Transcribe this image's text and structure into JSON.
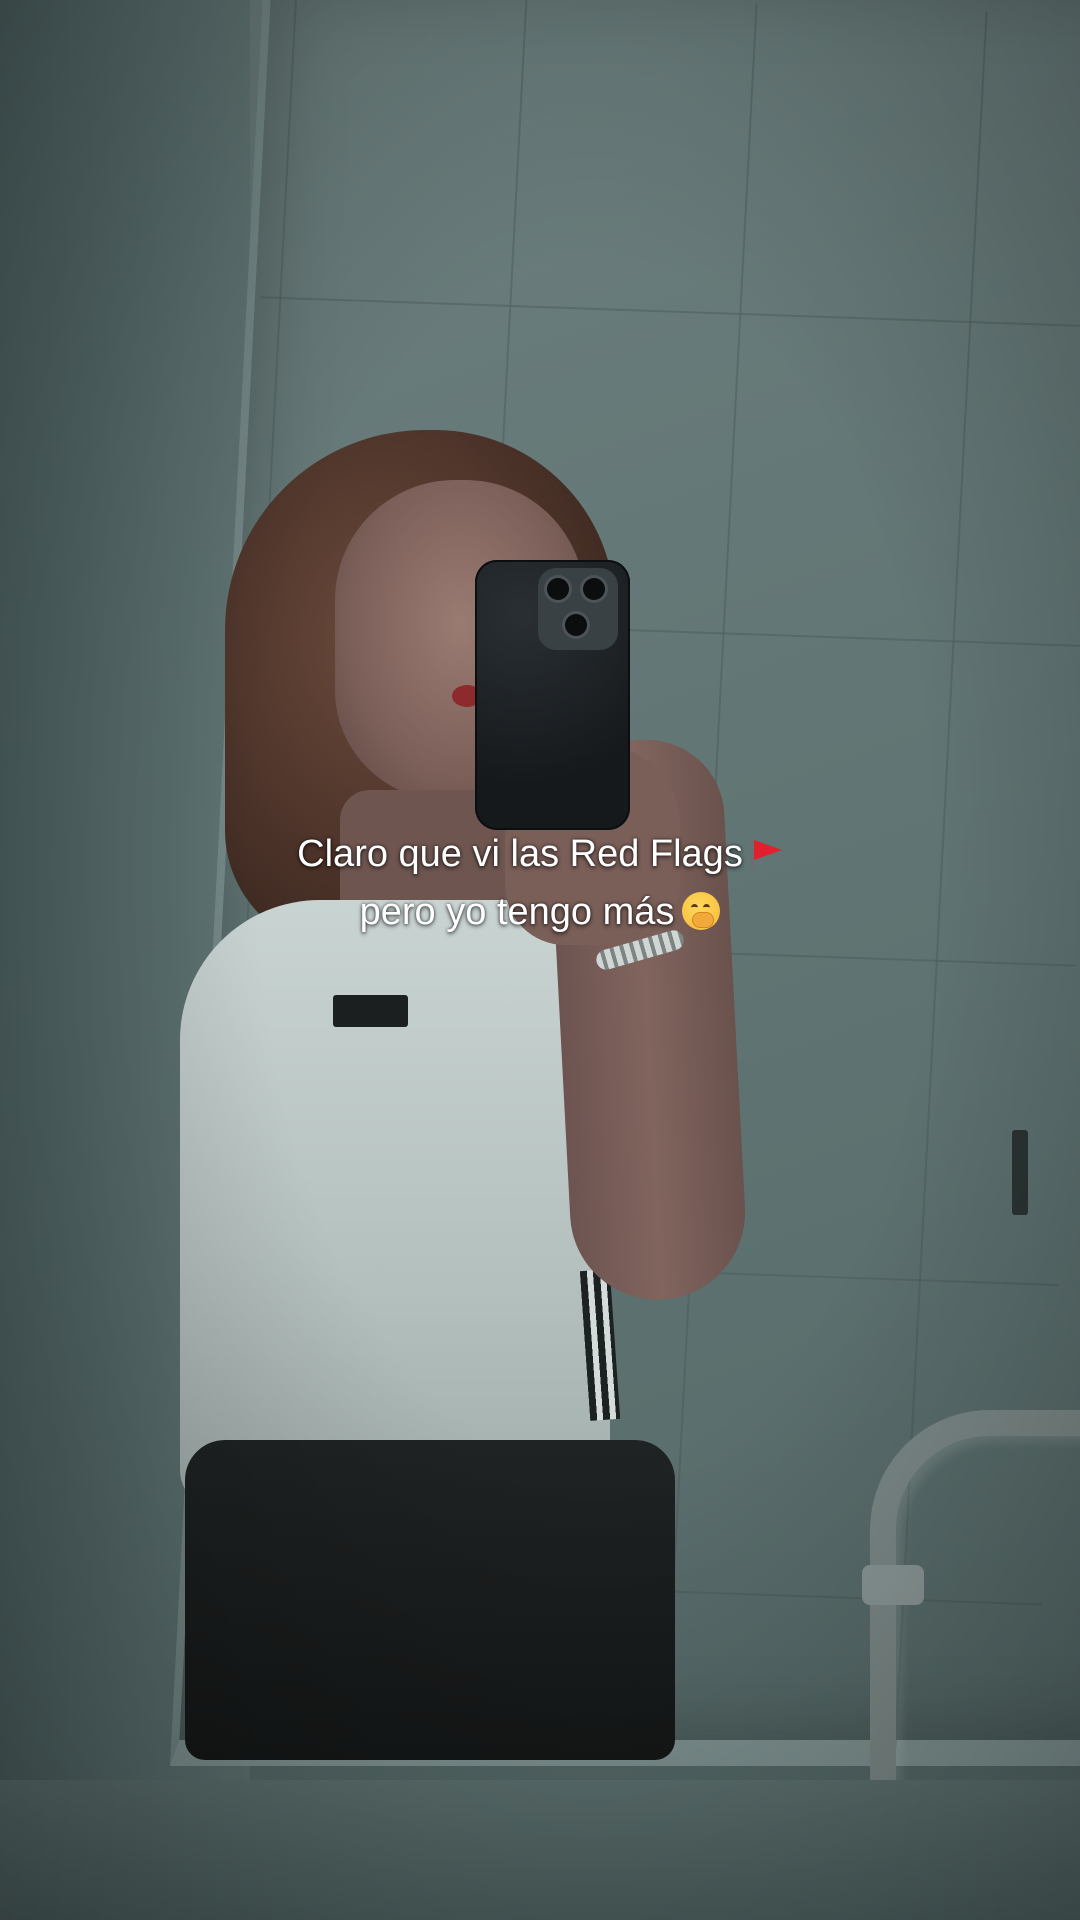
{
  "caption": {
    "line1": "Claro que vi las Red Flags",
    "line2": "pero yo tengo más",
    "line1_emoji": "red-flag-icon",
    "line2_emoji": "face-with-hand-over-mouth-icon",
    "text_color": "#ffffff"
  },
  "scene": {
    "tile_color": "#627675",
    "shirt_color": "#c9d4d2",
    "pants_color": "#1f2323"
  }
}
